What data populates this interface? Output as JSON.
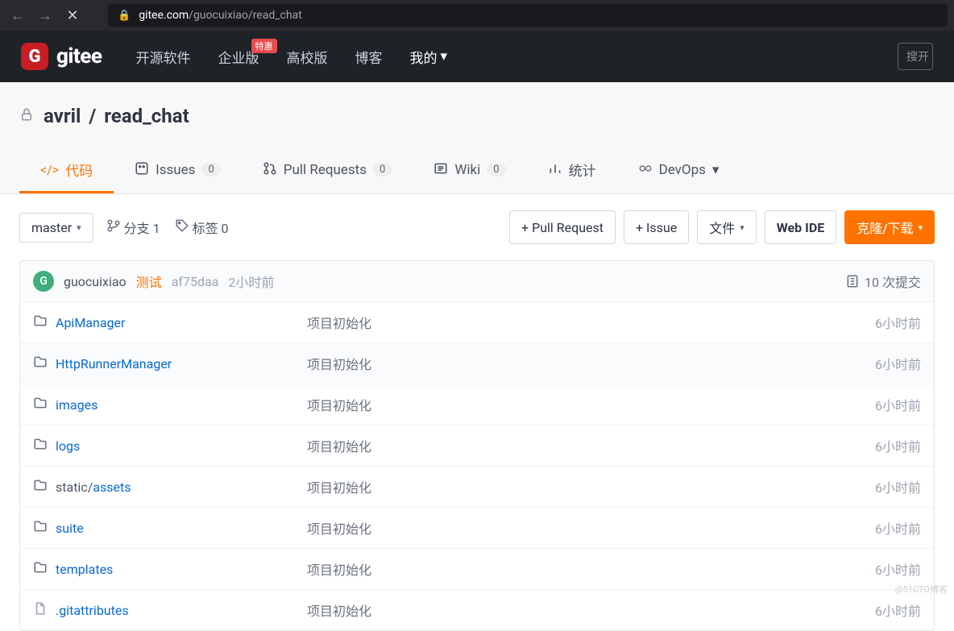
{
  "browser": {
    "url_domain": "gitee.com",
    "url_path": "/guocuixiao/read_chat"
  },
  "header": {
    "logo_text": "gitee",
    "logo_badge": "G",
    "nav": {
      "open_source": "开源软件",
      "enterprise": "企业版",
      "promo_badge": "特惠",
      "university": "高校版",
      "blog": "博客",
      "mine": "我的"
    },
    "search_placeholder": "搜开"
  },
  "repo": {
    "owner": "avril",
    "name": "read_chat"
  },
  "tabs": {
    "code": "代码",
    "issues": "Issues",
    "issues_count": "0",
    "pulls": "Pull Requests",
    "pulls_count": "0",
    "wiki": "Wiki",
    "wiki_count": "0",
    "stats": "统计",
    "devops": "DevOps"
  },
  "toolbar": {
    "branch": "master",
    "branches_label": "分支 1",
    "tags_label": "标签 0",
    "new_pr": "+ Pull Request",
    "new_issue": "+ Issue",
    "files": "文件",
    "web_ide": "Web IDE",
    "clone": "克隆/下载"
  },
  "commit": {
    "avatar_letter": "G",
    "author": "guocuixiao",
    "message": "测试",
    "sha": "af75daa",
    "time": "2小时前",
    "count_label": "10 次提交"
  },
  "files": [
    {
      "name": "ApiManager",
      "name2": "",
      "msg": "项目初始化",
      "time": "6小时前",
      "type": "dir",
      "alt": false
    },
    {
      "name": "HttpRunnerManager",
      "name2": "",
      "msg": "项目初始化",
      "time": "6小时前",
      "type": "dir",
      "alt": true
    },
    {
      "name": "images",
      "name2": "",
      "msg": "项目初始化",
      "time": "6小时前",
      "type": "dir",
      "alt": false
    },
    {
      "name": "logs",
      "name2": "",
      "msg": "项目初始化",
      "time": "6小时前",
      "type": "dir",
      "alt": false
    },
    {
      "name": "static/",
      "name2": "assets",
      "msg": "项目初始化",
      "time": "6小时前",
      "type": "dir",
      "alt": false
    },
    {
      "name": "suite",
      "name2": "",
      "msg": "项目初始化",
      "time": "6小时前",
      "type": "dir",
      "alt": false
    },
    {
      "name": "templates",
      "name2": "",
      "msg": "项目初始化",
      "time": "6小时前",
      "type": "dir",
      "alt": false
    },
    {
      "name": ".gitattributes",
      "name2": "",
      "msg": "项目初始化",
      "time": "6小时前",
      "type": "file",
      "alt": false
    }
  ],
  "watermark": "@51CTO博客"
}
